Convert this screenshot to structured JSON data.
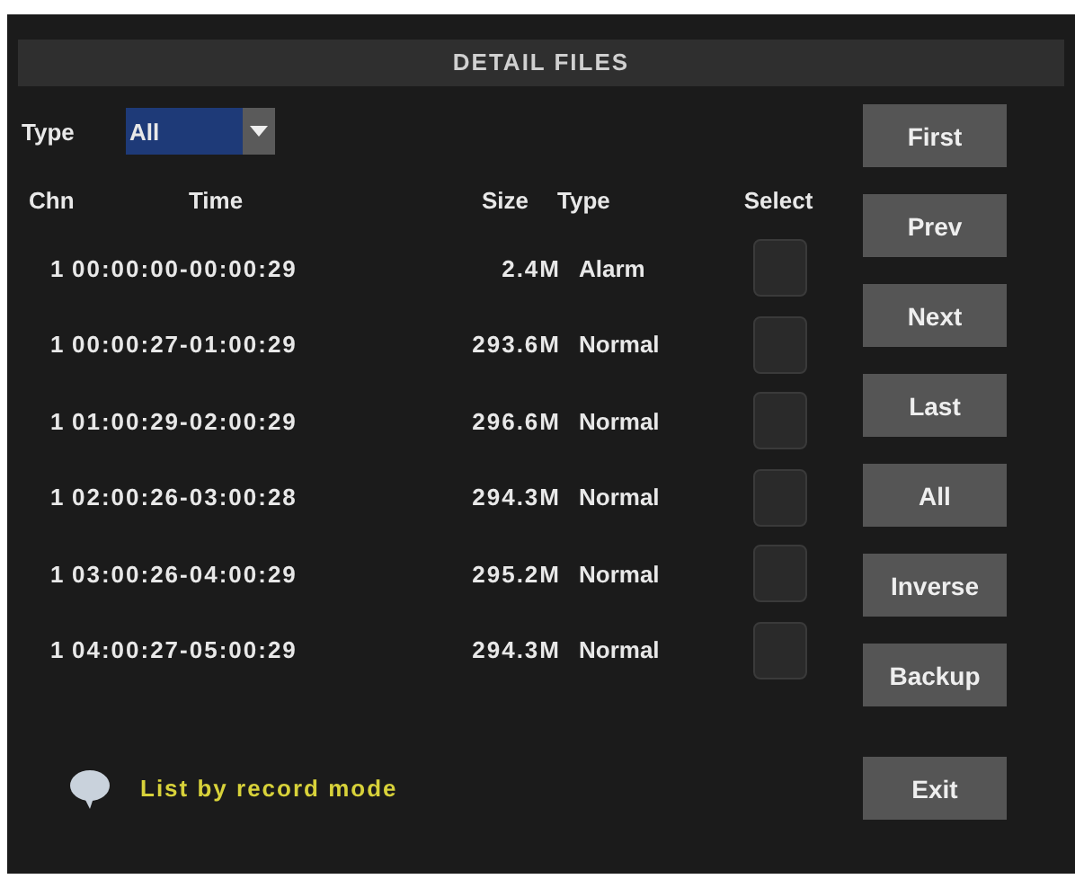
{
  "window": {
    "title": "DETAIL FILES"
  },
  "filter": {
    "label": "Type",
    "value": "All"
  },
  "table": {
    "columns": [
      "Chn",
      "Time",
      "Size",
      "Type",
      "Select"
    ],
    "rows": [
      {
        "chn": "1",
        "time": "00:00:00-00:00:29",
        "size": "2.4M",
        "type": "Alarm",
        "checked": false
      },
      {
        "chn": "1",
        "time": "00:00:27-01:00:29",
        "size": "293.6M",
        "type": "Normal",
        "checked": false
      },
      {
        "chn": "1",
        "time": "01:00:29-02:00:29",
        "size": "296.6M",
        "type": "Normal",
        "checked": false
      },
      {
        "chn": "1",
        "time": "02:00:26-03:00:28",
        "size": "294.3M",
        "type": "Normal",
        "checked": false
      },
      {
        "chn": "1",
        "time": "03:00:26-04:00:29",
        "size": "295.2M",
        "type": "Normal",
        "checked": false
      },
      {
        "chn": "1",
        "time": "04:00:27-05:00:29",
        "size": "294.3M",
        "type": "Normal",
        "checked": false
      }
    ]
  },
  "buttons": [
    "First",
    "Prev",
    "Next",
    "Last",
    "All",
    "Inverse",
    "Backup"
  ],
  "hint": "List by record mode",
  "exit_button": "Exit"
}
